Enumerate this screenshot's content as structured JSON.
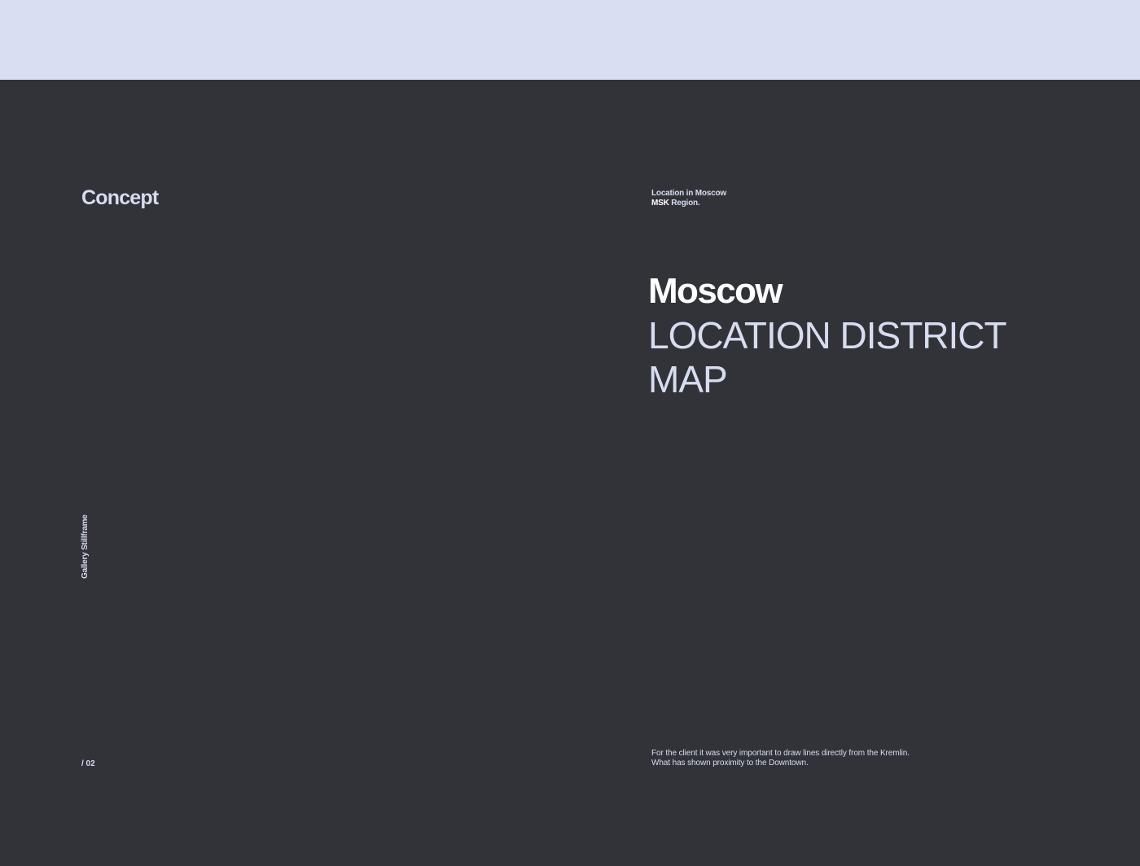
{
  "colors": {
    "top_band": "#d9def2",
    "background": "#313339",
    "text_light": "#d7dcf0",
    "text_white": "#ffffff"
  },
  "section_title": "Concept",
  "location_note": {
    "line1": "Location in Moscow",
    "line2_bold": "MSK",
    "line2_rest": "Region."
  },
  "heading": {
    "city": "Moscow",
    "line1": "LOCATION DISTRICT",
    "line2": "MAP"
  },
  "side_label": "Gallery Stillframe",
  "page_number": "/ 02",
  "description": {
    "line1": "For the client it was very important to draw lines directly from the Kremlin.",
    "line2": "What has shown proximity to the Downtown."
  }
}
